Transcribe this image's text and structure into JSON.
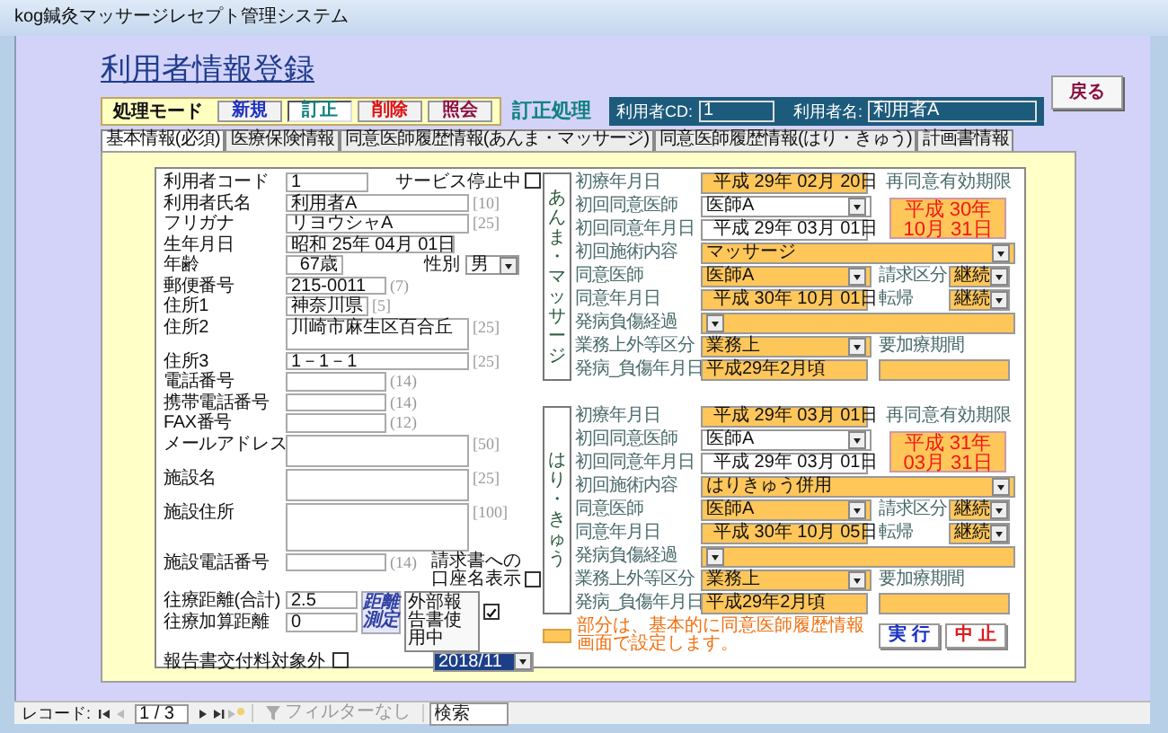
{
  "window": {
    "title": "kog鍼灸マッサージレセプト管理システム"
  },
  "header": {
    "title": "利用者情報登録",
    "back_button": "戻る"
  },
  "mode_bar": {
    "label": "処理モード",
    "status": "訂正処理",
    "buttons": [
      {
        "label": "新規",
        "kind": "new",
        "selected": false
      },
      {
        "label": "訂正",
        "kind": "edit",
        "selected": true
      },
      {
        "label": "削除",
        "kind": "delete",
        "selected": false
      },
      {
        "label": "照会",
        "kind": "view",
        "selected": false
      }
    ]
  },
  "user_bar": {
    "code_label": "利用者CD:",
    "code": "1",
    "name_label": "利用者名:",
    "name": "利用者A"
  },
  "tabs": [
    {
      "label": "基本情報(必須)",
      "selected": true
    },
    {
      "label": "医療保険情報",
      "selected": false
    },
    {
      "label": "同意医師履歴情報(あんま・マッサージ)",
      "selected": false
    },
    {
      "label": "同意医師履歴情報(はり・きゅう)",
      "selected": false
    },
    {
      "label": "計画書情報",
      "selected": false
    }
  ],
  "basic": {
    "rows": [
      {
        "label": "利用者コード",
        "value": "1",
        "kind": "short",
        "extra": {
          "kind": "checkbox",
          "label": "サービス停止中",
          "checked": false
        }
      },
      {
        "label": "利用者氏名",
        "value": "利用者A",
        "kind": "long",
        "hint": "[10]"
      },
      {
        "label": "フリガナ",
        "value": "リヨウシャA",
        "kind": "long",
        "hint": "[25]"
      },
      {
        "label": "生年月日",
        "value": "昭和 25年 04月 01日",
        "kind": "date"
      },
      {
        "label": "年齢",
        "value": "67歳",
        "kind": "age",
        "extra": {
          "kind": "select",
          "label": "性別",
          "value": "男"
        }
      },
      {
        "label": "郵便番号",
        "value": "215-0011",
        "kind": "medium",
        "hint": "(7)"
      },
      {
        "label": "住所1",
        "value": "神奈川県",
        "kind": "short",
        "hint": "[5]"
      },
      {
        "label": "住所2",
        "value": "川崎市麻生区百合丘",
        "kind": "memo",
        "hint": "[25]"
      },
      {
        "label": "住所3",
        "value": "1－1－1",
        "kind": "long",
        "hint": "[25]"
      },
      {
        "label": "電話番号",
        "kind": "medium",
        "hint": "(14)"
      },
      {
        "label": "携帯電話番号",
        "kind": "medium",
        "hint": "(14)"
      },
      {
        "label": "FAX番号",
        "kind": "medium",
        "hint": "(12)"
      },
      {
        "label": "メールアドレス",
        "kind": "memo",
        "hint": "[50]"
      },
      {
        "label": "施設名",
        "kind": "memo",
        "hint": "[25]"
      },
      {
        "label": "施設住所",
        "kind": "bigmemo",
        "hint": "[100]"
      },
      {
        "label": "施設電話番号",
        "kind": "medium",
        "hint": "(14)",
        "extra": {
          "kind": "checkbox",
          "label": "請求書への口座名表示",
          "checked": false
        }
      }
    ],
    "travel": {
      "distance_label": "往療距離(合計)",
      "distance": "2.5",
      "added_label": "往療加算距離",
      "added": "0",
      "measure_button": "距離測定",
      "external_label": "外部報告書使用中",
      "external_checked": true,
      "month": "2018/11",
      "report_label": "報告書交付料対象外",
      "report_checked": false
    }
  },
  "sections": [
    {
      "title": "あんま・マッサージ",
      "rows": [
        {
          "label": "初療年月日",
          "value": "平成 29年 02月 20日",
          "kind": "date",
          "highlight": true
        },
        {
          "label": "初回同意医師",
          "value": "医師A",
          "kind": "select",
          "highlight": false
        },
        {
          "label": "初回同意年月日",
          "value": "平成 29年 03月 01日",
          "kind": "date",
          "highlight": false
        },
        {
          "label": "初回施術内容",
          "value": "マッサージ",
          "kind": "wideselect",
          "highlight": true
        },
        {
          "label": "同意医師",
          "value": "医師A",
          "kind": "select",
          "highlight": true
        },
        {
          "label": "同意年月日",
          "value": "平成 30年 10月 01日",
          "kind": "date",
          "highlight": true
        },
        {
          "label": "発病負傷経過",
          "kind": "wideselect",
          "highlight": true
        },
        {
          "label": "業務上外等区分",
          "value": "業務上",
          "kind": "select",
          "highlight": true
        },
        {
          "label": "発病_負傷年月日",
          "value": "平成29年2月頃",
          "kind": "text",
          "highlight": true
        }
      ],
      "expiry": {
        "label": "再同意有効期限",
        "lines": [
          "平成 30年",
          "10月 31日"
        ]
      },
      "claim": {
        "label": "請求区分",
        "value": "継続"
      },
      "outcome": {
        "label": "転帰",
        "value": "継続"
      },
      "care_period": {
        "label": "要加療期間"
      }
    },
    {
      "title": "はり・きゅう",
      "rows": [
        {
          "label": "初療年月日",
          "value": "平成 29年 03月 01日",
          "kind": "date",
          "highlight": true
        },
        {
          "label": "初回同意医師",
          "value": "医師A",
          "kind": "select",
          "highlight": false
        },
        {
          "label": "初回同意年月日",
          "value": "平成 29年 03月 01日",
          "kind": "date",
          "highlight": false
        },
        {
          "label": "初回施術内容",
          "value": "はりきゅう併用",
          "kind": "wideselect",
          "highlight": true
        },
        {
          "label": "同意医師",
          "value": "医師A",
          "kind": "select",
          "highlight": true
        },
        {
          "label": "同意年月日",
          "value": "平成 30年 10月 05日",
          "kind": "date",
          "highlight": true
        },
        {
          "label": "発病負傷経過",
          "kind": "wideselect",
          "highlight": true
        },
        {
          "label": "業務上外等区分",
          "value": "業務上",
          "kind": "select",
          "highlight": true
        },
        {
          "label": "発病_負傷年月日",
          "value": "平成29年2月頃",
          "kind": "text",
          "highlight": true
        }
      ],
      "expiry": {
        "label": "再同意有効期限",
        "lines": [
          "平成 31年",
          "03月 31日"
        ]
      },
      "claim": {
        "label": "請求区分",
        "value": "継続"
      },
      "outcome": {
        "label": "転帰",
        "value": "継続"
      },
      "care_period": {
        "label": "要加療期間"
      }
    }
  ],
  "note": {
    "text": "部分は、基本的に同意医師履歴情報画面で設定します。",
    "buttons": [
      {
        "label": "実 行",
        "kind": "run"
      },
      {
        "label": "中 止",
        "kind": "cancel"
      }
    ]
  },
  "status_bar": {
    "record_label": "レコード:",
    "position": "1 / 3",
    "filter": "フィルターなし",
    "search": {
      "placeholder": "検索"
    }
  }
}
